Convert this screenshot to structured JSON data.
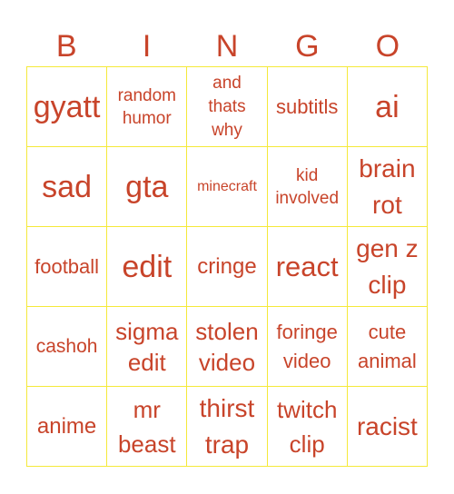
{
  "header": {
    "letters": [
      "B",
      "I",
      "N",
      "G",
      "O"
    ]
  },
  "colors": {
    "text": "#c8442a",
    "grid_lines": "#f5e93a",
    "background": "#ffffff"
  },
  "grid": {
    "rows": [
      [
        "gyatt",
        "random humor",
        "and thats why",
        "subtitls",
        "ai"
      ],
      [
        "sad",
        "gta",
        "minecraft",
        "kid involved",
        "brain rot"
      ],
      [
        "football",
        "edit",
        "cringe",
        "react",
        "gen z clip"
      ],
      [
        "cashoh",
        "sigma edit",
        "stolen video",
        "foringe video",
        "cute animal"
      ],
      [
        "anime",
        "mr beast",
        "thirst trap",
        "twitch clip",
        "racist"
      ]
    ]
  }
}
